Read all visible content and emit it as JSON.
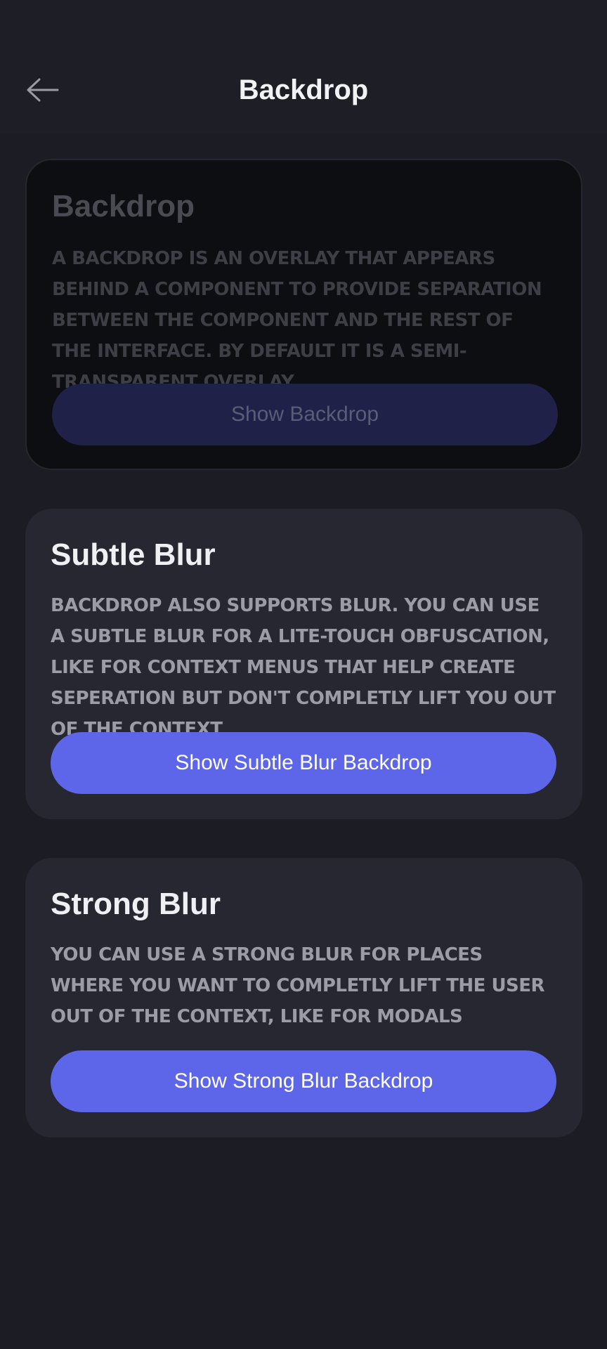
{
  "header": {
    "title": "Backdrop",
    "back_icon": "arrow-left-icon"
  },
  "cards": [
    {
      "title": "Backdrop",
      "description": "A backdrop is an overlay that appears behind a component to provide separation between the component and the rest of the interface. By default it is a semi-transparent overlay.",
      "button_label": "Show Backdrop"
    },
    {
      "title": "Subtle Blur",
      "description": "Backdrop also supports blur. You can use a subtle blur for a lite-touch obfuscation, like for context menus that help create seperation but don't completly lift you out of the context",
      "button_label": "Show Subtle Blur Backdrop"
    },
    {
      "title": "Strong Blur",
      "description": "You can use a strong blur for places where you want to completly lift the user out of the context, like for modals",
      "button_label": "Show Strong Blur Backdrop"
    }
  ],
  "colors": {
    "background": "#1c1c24",
    "card": "#272731",
    "accent": "#5d66e8"
  }
}
